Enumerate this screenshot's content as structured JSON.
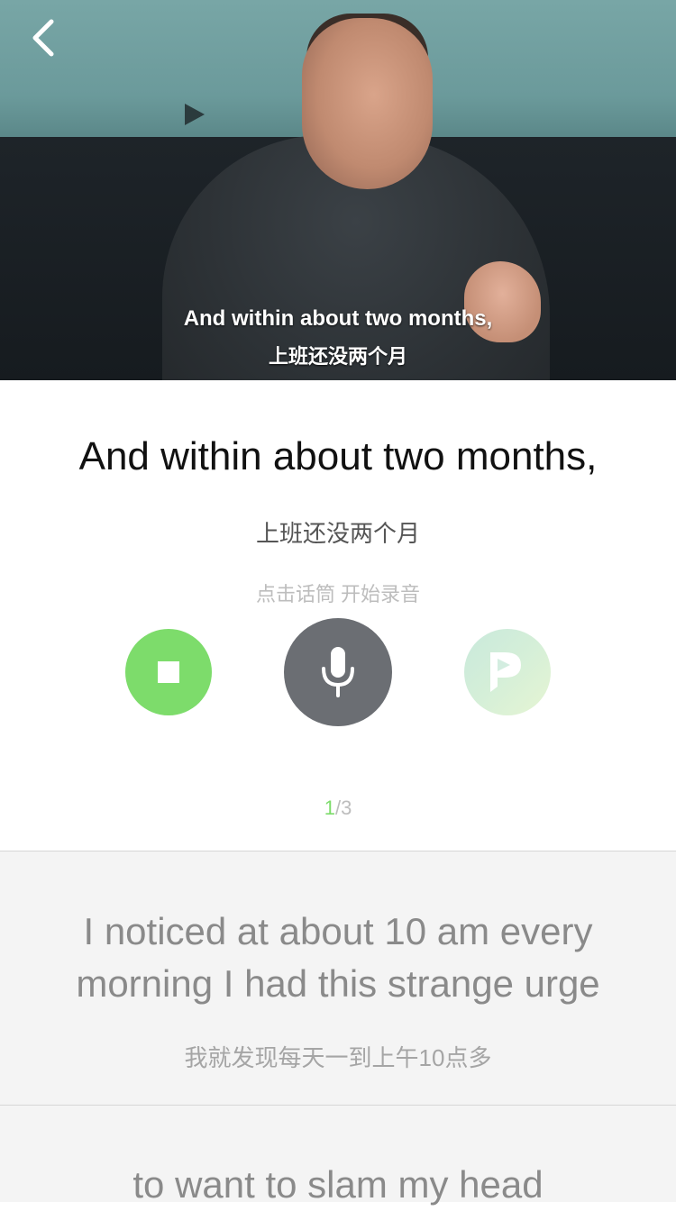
{
  "video": {
    "subtitle_en": "And within about two months,",
    "subtitle_zh": "上班还没两个月"
  },
  "current": {
    "text_en": "And within about two months,",
    "text_zh": "上班还没两个月",
    "hint": "点击话筒 开始录音"
  },
  "controls": {
    "stop_icon": "stop-icon",
    "mic_icon": "microphone-icon",
    "play_icon": "playback-icon"
  },
  "pager": {
    "current": "1",
    "separator": "/",
    "total": "3"
  },
  "upcoming": [
    {
      "text_en": "I noticed at about 10 am every morning I had this strange urge",
      "text_zh": "我就发现每天一到上午10点多"
    },
    {
      "text_en": "to want to slam my head",
      "text_zh": ""
    }
  ],
  "colors": {
    "accent_green": "#7ddc6b",
    "mic_gray": "#6b6e73",
    "list_bg": "#f4f4f4"
  }
}
